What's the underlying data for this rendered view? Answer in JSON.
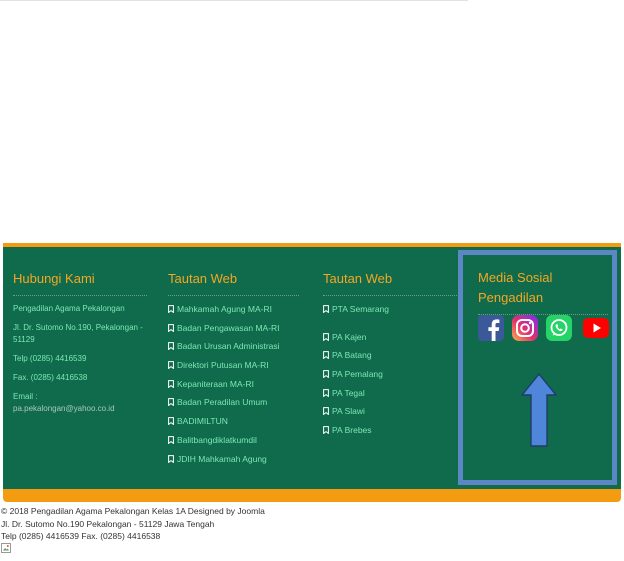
{
  "contact": {
    "title": "Hubungi Kami",
    "name": "Pengadilan Agama Pekalongan",
    "address": "Jl. Dr. Sutomo No.190, Pekalongan - 51129",
    "phone": "Telp (0285) 4416539",
    "fax": "Fax. (0285) 4416538",
    "email_label": "Email :",
    "email": "pa.pekalongan@yahoo.co.id"
  },
  "links1": {
    "title": "Tautan Web",
    "items": [
      "Mahkamah Agung MA-RI",
      "Badan Pengawasan MA-RI",
      "Badan Urusan Administrasi",
      "Direktori Putusan MA-RI",
      "Kepaniteraan MA-RI",
      "Badan Peradilan Umum",
      "BADIMILTUN",
      "Balitbangdiklatkumdil",
      "JDIH Mahkamah Agung"
    ]
  },
  "links2": {
    "title": "Tautan Web",
    "items": [
      "PTA Semarang",
      "PA Kajen",
      "PA Batang",
      "PA Pemalang",
      "PA Tegal",
      "PA Slawi",
      "PA Brebes"
    ]
  },
  "social": {
    "title": "Media Sosial Pengadilan",
    "icons": [
      "facebook-icon",
      "instagram-icon",
      "whatsapp-icon",
      "youtube-icon"
    ]
  },
  "bottom": {
    "copyright": "© 2018 Pengadilan Agama Pekalongan Kelas 1A Designed by Joomla",
    "address": "Jl. Dr. Sutomo No.190 Pekalongan - 51129 Jawa Tengah",
    "phone": "Telp (0285) 4416539 Fax. (0285) 4416538"
  },
  "colors": {
    "footer_bg": "#0f6b4c",
    "accent": "#f39c12",
    "title": "#f5a623",
    "link": "#7ee8b4",
    "social_border": "#5b87c5"
  }
}
